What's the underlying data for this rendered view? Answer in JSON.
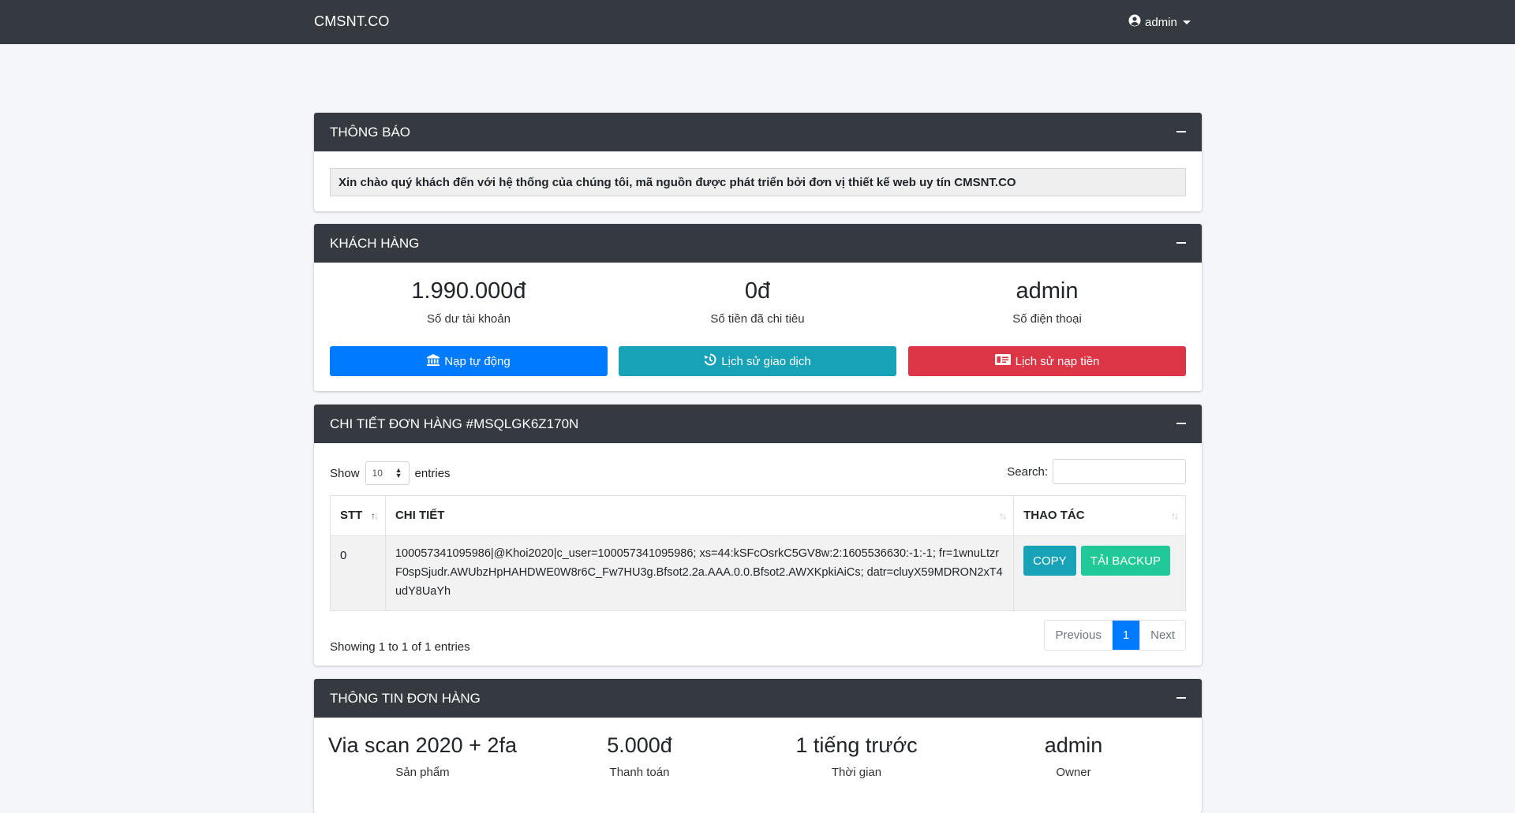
{
  "navbar": {
    "brand": "CMSNT.CO",
    "user": "admin"
  },
  "notice_card": {
    "title": "THÔNG BÁO",
    "message": "Xin chào quý khách đến với hệ thống của chúng tôi, mã nguồn được phát triển bởi đơn vị thiết kế web uy tín CMSNT.CO"
  },
  "customer_card": {
    "title": "KHÁCH HÀNG",
    "stats": [
      {
        "value": "1.990.000đ",
        "label": "Số dư tài khoản"
      },
      {
        "value": "0đ",
        "label": "Số tiền đã chi tiêu"
      },
      {
        "value": "admin",
        "label": "Số điện thoại"
      }
    ],
    "buttons": {
      "auto_topup": "Nạp tự động",
      "transaction_history": "Lịch sử giao dịch",
      "topup_history": "Lịch sử nạp tiền"
    }
  },
  "order_detail_card": {
    "title": "CHI TIẾT ĐƠN HÀNG #MSQLGK6Z170N",
    "show_label": "Show",
    "entries_value": "10",
    "entries_label": "entries",
    "search_label": "Search:",
    "columns": [
      "STT",
      "CHI TIẾT",
      "THAO TÁC"
    ],
    "rows": [
      {
        "stt": "0",
        "detail": "100057341095986|@Khoi2020|c_user=100057341095986; xs=44:kSFcOsrkC5GV8w:2:1605536630:-1:-1; fr=1wnuLtzrF0spSjudr.AWUbzHpHAHDWE0W8r6C_Fw7HU3g.Bfsot2.2a.AAA.0.0.Bfsot2.AWXKpkiAiCs; datr=cluyX59MDRON2xT4udY8UaYh",
        "copy_label": "COPY",
        "backup_label": "TẢI BACKUP"
      }
    ],
    "info": "Showing 1 to 1 of 1 entries",
    "pagination": {
      "previous": "Previous",
      "current": "1",
      "next": "Next"
    }
  },
  "order_info_card": {
    "title": "THÔNG TIN ĐƠN HÀNG",
    "items": [
      {
        "value": "Via scan 2020 + 2fa",
        "label": "Sản phẩm"
      },
      {
        "value": "5.000đ",
        "label": "Thanh toán"
      },
      {
        "value": "1 tiếng trước",
        "label": "Thời gian"
      },
      {
        "value": "admin",
        "label": "Owner"
      }
    ]
  }
}
